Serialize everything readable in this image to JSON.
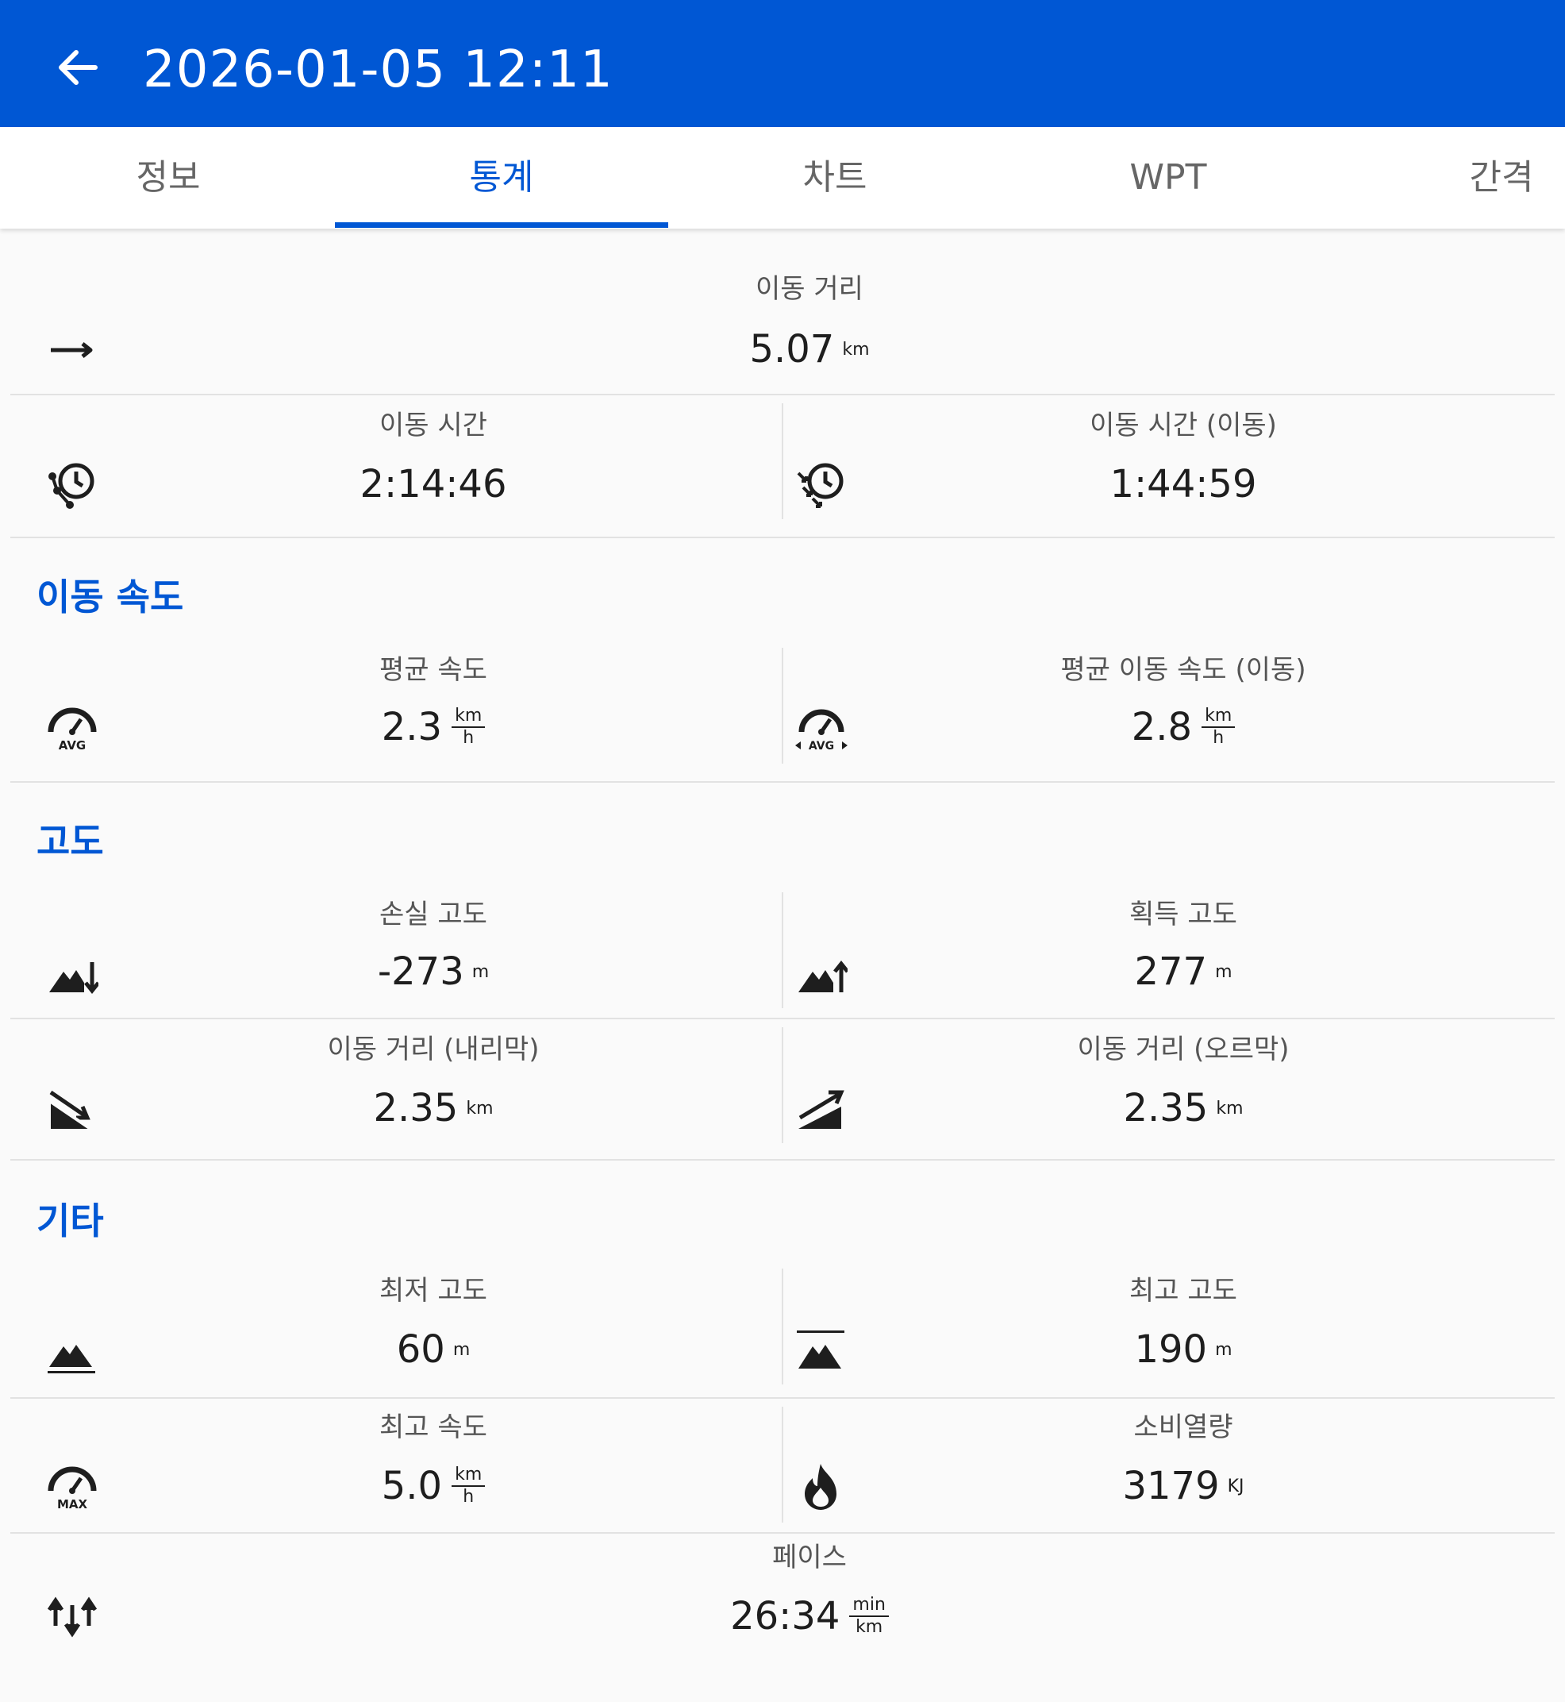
{
  "header": {
    "title": "2026-01-05 12:11",
    "back_icon": "arrow-back-icon"
  },
  "tabs": [
    {
      "label": "정보",
      "active": false
    },
    {
      "label": "통계",
      "active": true
    },
    {
      "label": "차트",
      "active": false
    },
    {
      "label": "WPT",
      "active": false
    },
    {
      "label": "간격",
      "active": false
    }
  ],
  "stats": {
    "distance": {
      "label": "이동 거리",
      "value": "5.07",
      "unit": "km",
      "icon": "arrow-right-icon"
    },
    "time": {
      "label": "이동 시간",
      "value": "2:14:46",
      "icon": "clock-path-icon"
    },
    "time_moving": {
      "label": "이동 시간 (이동)",
      "value": "1:44:59",
      "icon": "clock-arrows-icon"
    }
  },
  "speed": {
    "section_title": "이동 속도",
    "avg": {
      "label": "평균 속도",
      "value": "2.3",
      "unit_top": "km",
      "unit_bottom": "h",
      "badge": "AVG",
      "icon": "speedometer-avg-icon"
    },
    "avg_moving": {
      "label": "평균 이동 속도 (이동)",
      "value": "2.8",
      "unit_top": "km",
      "unit_bottom": "h",
      "badge": "AVG",
      "icon": "speedometer-avg-moving-icon"
    }
  },
  "elevation": {
    "section_title": "고도",
    "loss": {
      "label": "손실 고도",
      "value": "-273",
      "unit": "m",
      "icon": "elevation-loss-icon"
    },
    "gain": {
      "label": "획득 고도",
      "value": "277",
      "unit": "m",
      "icon": "elevation-gain-icon"
    },
    "dist_down": {
      "label": "이동 거리 (내리막)",
      "value": "2.35",
      "unit": "km",
      "icon": "downhill-icon"
    },
    "dist_up": {
      "label": "이동 거리 (오르막)",
      "value": "2.35",
      "unit": "km",
      "icon": "uphill-icon"
    }
  },
  "other": {
    "section_title": "기타",
    "min_alt": {
      "label": "최저 고도",
      "value": "60",
      "unit": "m",
      "icon": "min-altitude-icon"
    },
    "max_alt": {
      "label": "최고 고도",
      "value": "190",
      "unit": "m",
      "icon": "max-altitude-icon"
    },
    "max_speed": {
      "label": "최고 속도",
      "value": "5.0",
      "unit_top": "km",
      "unit_bottom": "h",
      "badge": "MAX",
      "icon": "speedometer-max-icon"
    },
    "calories": {
      "label": "소비열량",
      "value": "3179",
      "unit": "KJ",
      "icon": "flame-icon"
    },
    "pace": {
      "label": "페이스",
      "value": "26:34",
      "unit_top": "min",
      "unit_bottom": "km",
      "icon": "pace-arrows-icon"
    }
  },
  "colors": {
    "primary": "#0057d4",
    "text": "#1e1e1e",
    "label": "#555555",
    "divider": "#e2e2e2"
  }
}
